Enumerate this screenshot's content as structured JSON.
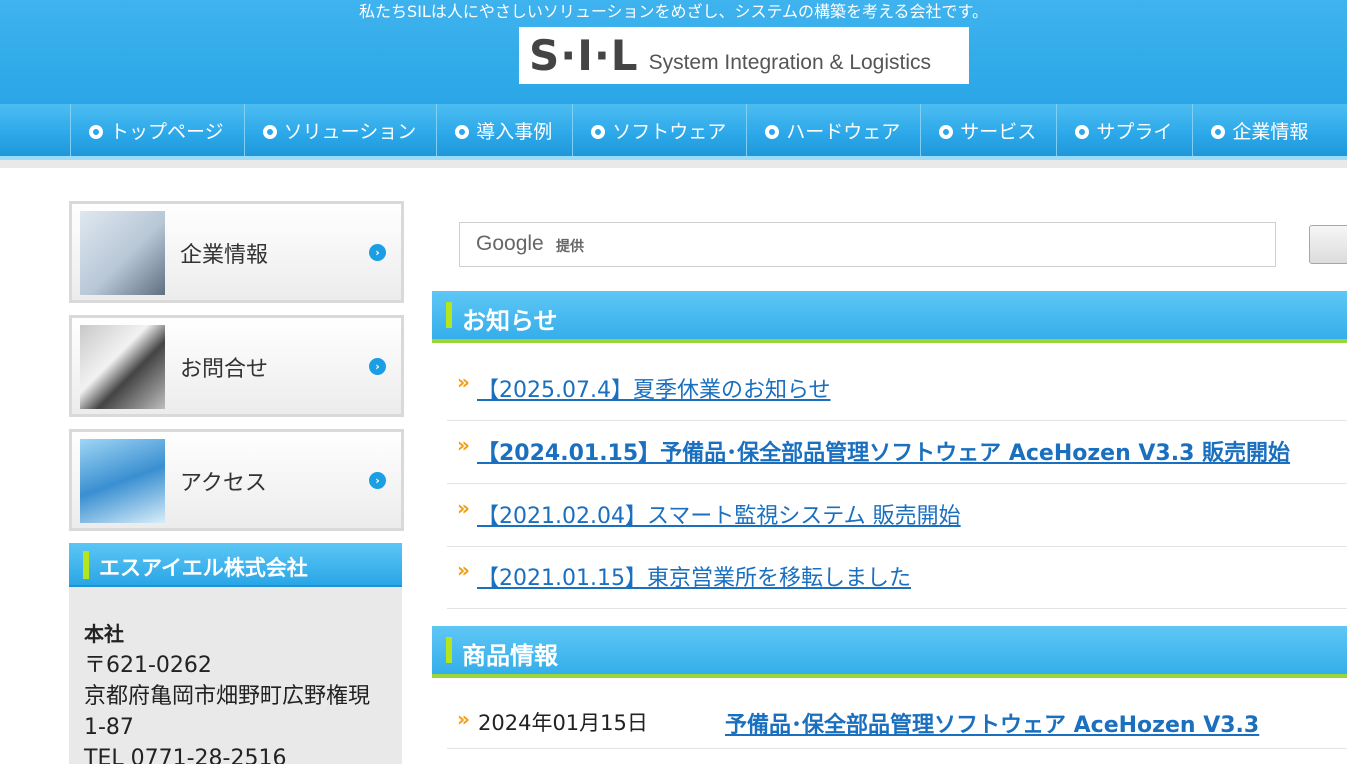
{
  "header": {
    "tagline": "私たちSILは人にやさしいソリューションをめざし、システムの構築を考える会社です。",
    "logo_mark": "S·I·L",
    "logo_sub": "System Integration & Logistics"
  },
  "nav": {
    "items": [
      "トップページ",
      "ソリューション",
      "導入事例",
      "ソフトウェア",
      "ハードウェア",
      "サービス",
      "サプライ",
      "企業情報"
    ]
  },
  "sidebar": {
    "cards": [
      {
        "label": "企業情報"
      },
      {
        "label": "お問合せ"
      },
      {
        "label": "アクセス"
      }
    ],
    "company": {
      "title": "エスアイエル株式会社",
      "hq_label": "本社",
      "postal": "〒621-0262",
      "address1": "京都府亀岡市畑野町広野権現",
      "address2": "1-87",
      "tel": "TEL 0771-28-2516"
    }
  },
  "search": {
    "brand": "Google",
    "provided": "提供"
  },
  "news": {
    "title": "お知らせ",
    "items": [
      {
        "text": "【2025.07.4】夏季休業のお知らせ",
        "bold": false
      },
      {
        "text": "【2024.01.15】予備品･保全部品管理ソフトウェア AceHozen V3.3 販売開始",
        "bold": true
      },
      {
        "text": "【2021.02.04】スマート監視システム 販売開始",
        "bold": false
      },
      {
        "text": "【2021.01.15】東京営業所を移転しました",
        "bold": false
      }
    ]
  },
  "products": {
    "title": "商品情報",
    "items": [
      {
        "date": "2024年01月15日",
        "name": "予備品･保全部品管理ソフトウェア AceHozen V3.3"
      }
    ]
  },
  "colors": {
    "accent_blue": "#2aa6e6",
    "accent_green": "#b5e61d",
    "link": "#1a6fbf",
    "chevron": "#f39c12"
  }
}
